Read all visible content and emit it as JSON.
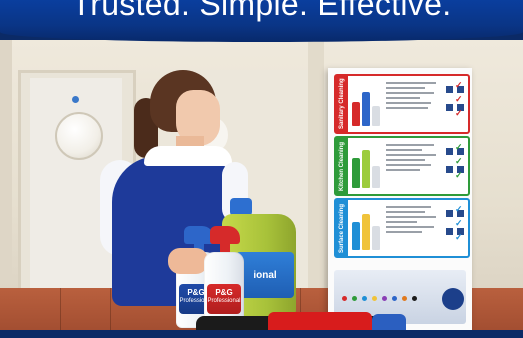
{
  "banner": {
    "tagline": "Trusted. Simple. Effective."
  },
  "chart_poster": {
    "panels": [
      {
        "label": "Sanitary Cleaning",
        "color": "#d62a2a",
        "tick_color": "#d62a2a",
        "bottle_colors": [
          "#d62a2a",
          "#2d66c9",
          "#e8e8e8"
        ]
      },
      {
        "label": "Kitchen Cleaning",
        "color": "#2e9b3a",
        "tick_color": "#2e9b3a",
        "bottle_colors": [
          "#2e9b3a",
          "#9ccc3c",
          "#e8e8e8"
        ]
      },
      {
        "label": "Surface Cleaning",
        "color": "#1f8fd6",
        "tick_color": "#1f8fd6",
        "bottle_colors": [
          "#1f8fd6",
          "#f0c33a",
          "#e8e8e8"
        ]
      }
    ],
    "tick_symbol": "✓"
  },
  "products": {
    "large_bottle_label": "ional",
    "spray_label_brand": "P&G",
    "spray_label_sub": "Professional"
  },
  "colors": {
    "brand_blue": "#0a3586",
    "uniform_blue": "#1e3a9a",
    "floor_red": "#a9512f"
  }
}
